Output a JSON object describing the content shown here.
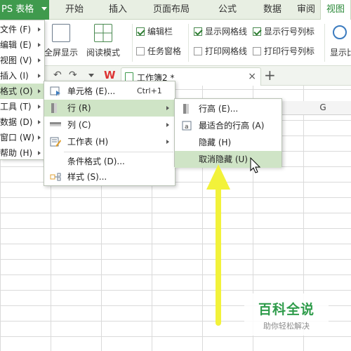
{
  "app": {
    "menu_button_label": "PS 表格"
  },
  "tabs": [
    {
      "label": "开始"
    },
    {
      "label": "插入"
    },
    {
      "label": "页面布局"
    },
    {
      "label": "公式"
    },
    {
      "label": "数据"
    },
    {
      "label": "审阅"
    },
    {
      "label": "视图",
      "active": true
    }
  ],
  "ribbon": {
    "fullscreen_label": "全屏显示",
    "reading_mode_label": "阅读模式",
    "display_label": "显示比",
    "checkboxes": [
      {
        "label": "编辑栏",
        "checked": true
      },
      {
        "label": "任务窗格",
        "checked": false
      },
      {
        "label": "显示网格线",
        "checked": true
      },
      {
        "label": "打印网格线",
        "checked": false
      },
      {
        "label": "显示行号列标",
        "checked": true
      },
      {
        "label": "打印行号列标",
        "checked": false
      }
    ]
  },
  "document_tab": {
    "name": "工作簿2 *",
    "close_glyph": "×",
    "new_tab_glyph": "+"
  },
  "column_header_visible": "G",
  "main_menu": {
    "items": [
      {
        "label": "文件 (F)"
      },
      {
        "label": "编辑 (E)"
      },
      {
        "label": "视图 (V)"
      },
      {
        "label": "插入 (I)"
      },
      {
        "label": "格式 (O)",
        "active": true
      },
      {
        "label": "工具 (T)"
      },
      {
        "label": "数据 (D)"
      },
      {
        "label": "窗口 (W)"
      },
      {
        "label": "帮助 (H)"
      }
    ]
  },
  "format_menu": {
    "items": [
      {
        "label": "单元格 (E)...",
        "shortcut": "Ctrl+1",
        "icon": "cell-icon"
      },
      {
        "label": "行 (R)",
        "active": true,
        "icon": "row-icon"
      },
      {
        "label": "列 (C)",
        "icon": "column-icon"
      },
      {
        "label": "工作表 (H)",
        "icon": "sheet-icon"
      },
      {
        "label": "条件格式 (D)..."
      },
      {
        "label": "样式 (S)...",
        "icon": "style-icon"
      }
    ]
  },
  "row_menu": {
    "items": [
      {
        "label": "行高 (E)...",
        "icon": "row-height-icon"
      },
      {
        "label": "最适合的行高 (A)",
        "icon": "autofit-row-icon"
      },
      {
        "label": "隐藏 (H)"
      },
      {
        "label": "取消隐藏 (U)",
        "active": true
      }
    ]
  },
  "watermark": {
    "title": "百科全说",
    "subtitle": "助你轻松解决"
  },
  "colors": {
    "accent_green": "#3f9a4d",
    "menu_highlight": "#cfe4c6",
    "annotation_arrow": "#f2f23a"
  }
}
